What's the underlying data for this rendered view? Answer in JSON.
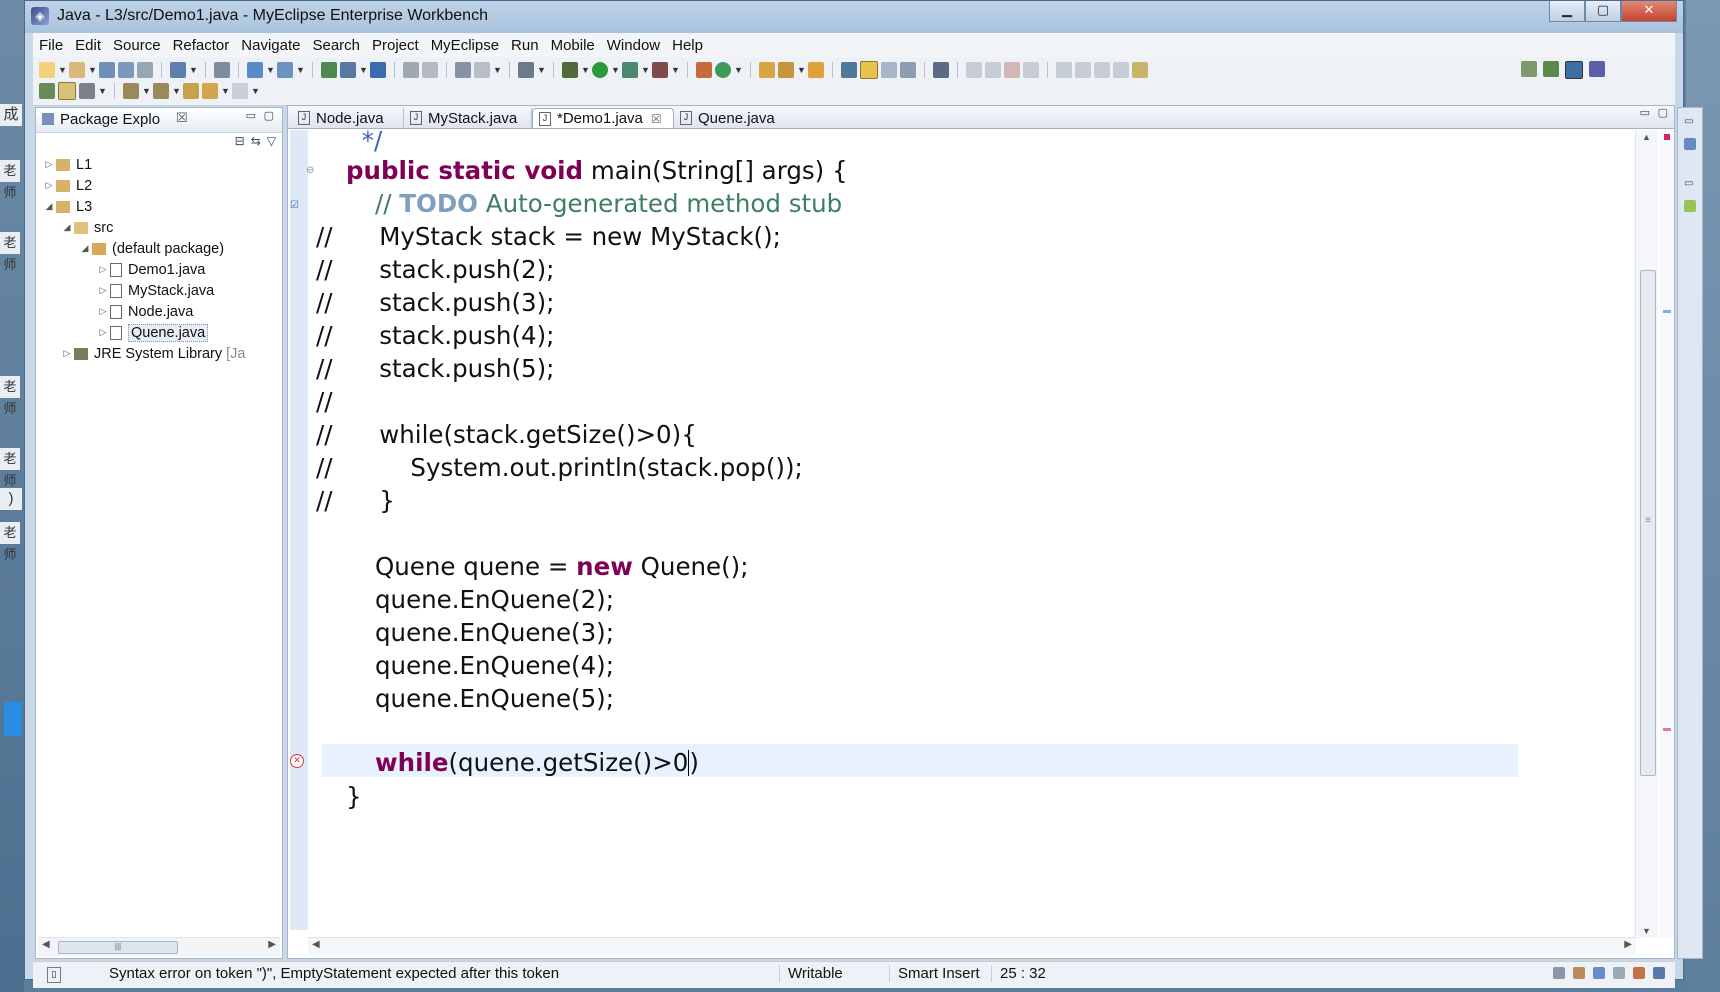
{
  "window": {
    "title": "Java - L3/src/Demo1.java - MyEclipse Enterprise Workbench",
    "minimize": "▁",
    "maximize": "▢",
    "close": "✕"
  },
  "desktop_fragments": [
    "成",
    "老师",
    "老师",
    "老师",
    "老师",
    ")",
    "老师"
  ],
  "menu": [
    "File",
    "Edit",
    "Source",
    "Refactor",
    "Navigate",
    "Search",
    "Project",
    "MyEclipse",
    "Run",
    "Mobile",
    "Window",
    "Help"
  ],
  "package_explorer": {
    "title": "Package Explo",
    "close": "☒",
    "items": [
      {
        "label": "L1",
        "depth": 0,
        "twisty": "▷"
      },
      {
        "label": "L2",
        "depth": 0,
        "twisty": "▷"
      },
      {
        "label": "L3",
        "depth": 0,
        "twisty": "◢"
      },
      {
        "label": "src",
        "depth": 1,
        "twisty": "◢"
      },
      {
        "label": "(default package)",
        "depth": 2,
        "twisty": "◢"
      },
      {
        "label": "Demo1.java",
        "depth": 3,
        "twisty": "▷"
      },
      {
        "label": "MyStack.java",
        "depth": 3,
        "twisty": "▷"
      },
      {
        "label": "Node.java",
        "depth": 3,
        "twisty": "▷"
      },
      {
        "label": "Quene.java",
        "depth": 3,
        "twisty": "▷",
        "selected": true
      },
      {
        "label": "JRE System Library",
        "suffix": "[Ja",
        "depth": 1,
        "twisty": "▷"
      }
    ]
  },
  "editor": {
    "tabs": [
      {
        "label": "Node.java",
        "active": false
      },
      {
        "label": "MyStack.java",
        "active": false
      },
      {
        "label": "*Demo1.java",
        "active": true,
        "close": "☒"
      },
      {
        "label": "Quene.java",
        "active": false
      }
    ],
    "lines": {
      "l0": " */",
      "l1_kw": "public static void",
      "l1_rest": " main(String[] args) {",
      "l2_pre": "// ",
      "l2_todo": "TODO",
      "l2_rest": " Auto-generated method stub",
      "c1": "//      MyStack stack = new MyStack();",
      "c2": "//      stack.push(2);",
      "c3": "//      stack.push(3);",
      "c4": "//      stack.push(4);",
      "c5": "//      stack.push(5);",
      "c6": "//",
      "c7": "//      while(stack.getSize()>0){",
      "c8": "//          System.out.println(stack.pop());",
      "c9": "//      }",
      "q1_a": "Quene quene = ",
      "q1_kw": "new",
      "q1_b": " Quene();",
      "q2": "quene.EnQuene(2);",
      "q3": "quene.EnQuene(3);",
      "q4": "quene.EnQuene(4);",
      "q5": "quene.EnQuene(5);",
      "w_kw": "while",
      "w_a": "(quene.getSize()>0",
      "w_b": ")",
      "close_brace": "}"
    }
  },
  "status": {
    "message": "Syntax error on token \")\", EmptyStatement expected after this token",
    "writable": "Writable",
    "insert_mode": "Smart Insert",
    "position": "25 : 32"
  },
  "colors": {
    "keyword": "#7f0055",
    "comment": "#3f7f5f",
    "todo": "#7f9fbf",
    "current_line": "#e8f2fe",
    "error": "#d23a3a"
  }
}
